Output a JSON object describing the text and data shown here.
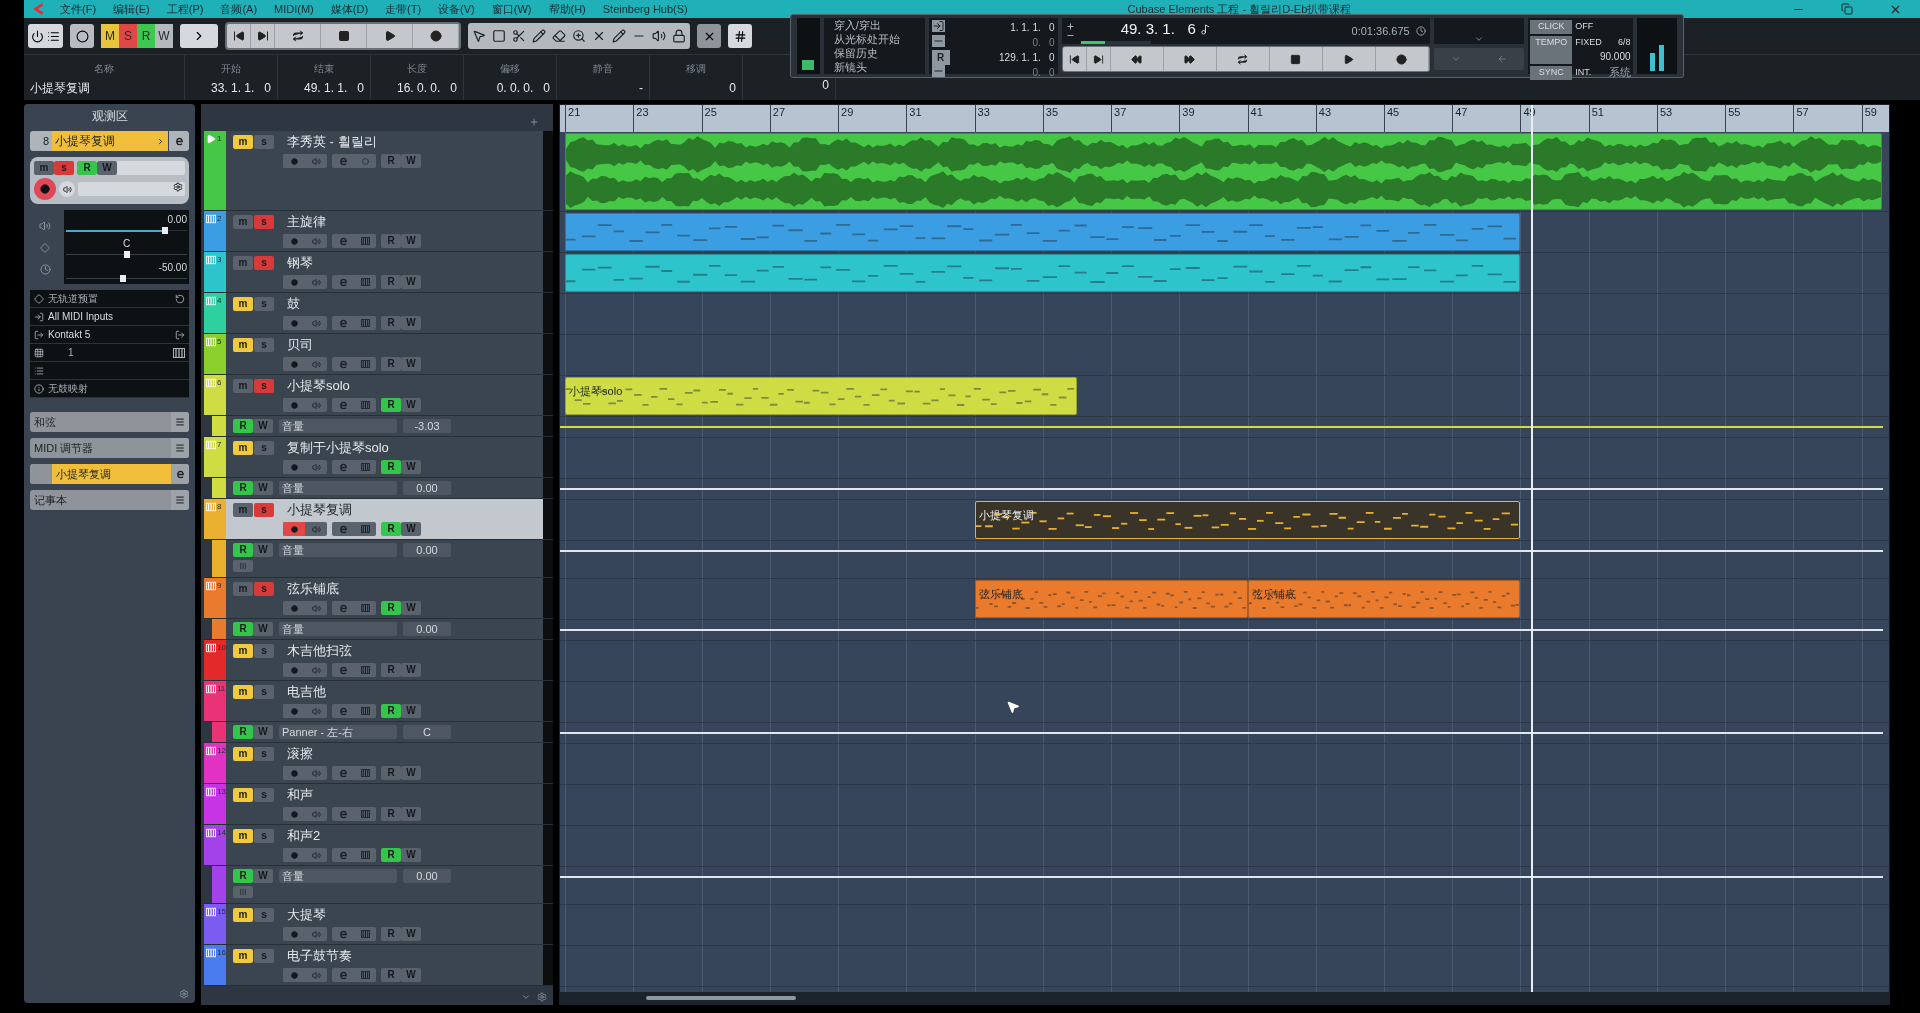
{
  "window": {
    "title": "Cubase Elements 工程 - 휠릴리D-Eb扒带课程"
  },
  "menu": [
    "文件(F)",
    "编辑(E)",
    "工程(P)",
    "音频(A)",
    "MIDI(M)",
    "媒体(D)",
    "走带(T)",
    "设备(V)",
    "窗口(W)",
    "帮助(H)",
    "Steinberg Hub(S)"
  ],
  "toolbar": {
    "states": [
      {
        "label": "M",
        "color": "#e8c43c"
      },
      {
        "label": "S",
        "color": "#e04848"
      },
      {
        "label": "R",
        "color": "#3cc850"
      },
      {
        "label": "W",
        "color": "#b4b9be"
      }
    ]
  },
  "info_line": {
    "fields": [
      {
        "label": "名称",
        "value": "小提琴复调"
      },
      {
        "label": "开始",
        "value": "33. 1. 1.   0"
      },
      {
        "label": "结束",
        "value": "49. 1. 1.   0"
      },
      {
        "label": "长度",
        "value": "16. 0. 0.   0"
      },
      {
        "label": "偏移",
        "value": "0. 0. 0.   0"
      },
      {
        "label": "静音",
        "value": "-"
      },
      {
        "label": "移调",
        "value": "0"
      },
      {
        "value": "0"
      }
    ]
  },
  "transport": {
    "options": [
      "穿入/穿出",
      "从光标处开始",
      "保留历史",
      "新镜头"
    ],
    "left_locator": "1. 1. 1.   0",
    "left_offset": "0.   0",
    "right_label": "R",
    "right_locator": "129. 1. 1.   0",
    "right_offset": "0.   0",
    "position": "49. 3. 1.   6",
    "time": "0:01:36.675",
    "level": 0.35,
    "click": {
      "label": "CLICK",
      "value": "OFF"
    },
    "tempo": {
      "label": "TEMPO",
      "mode": "FIXED",
      "signature": "6/8",
      "value": "90.000"
    },
    "sync": {
      "label": "SYNC",
      "value": "INT.",
      "source": "系统"
    }
  },
  "inspector": {
    "title": "观测区",
    "track": {
      "number": "8",
      "name": "小提琴复调"
    },
    "buttons": [
      {
        "label": "m",
        "on": false
      },
      {
        "label": "s",
        "on": true
      },
      {
        "label": "R",
        "on": true
      },
      {
        "label": "W",
        "on": false
      }
    ],
    "record": true,
    "volume": {
      "value": "0.00",
      "level": 0.82
    },
    "pan": {
      "value": "C",
      "level": 0.5
    },
    "delay": {
      "value": "-50.00",
      "level": 0.47
    },
    "rows": [
      {
        "kind": "preset",
        "text": "无轨道预置"
      },
      {
        "kind": "input",
        "text": "All MIDI Inputs"
      },
      {
        "kind": "output",
        "text": "Kontakt 5"
      },
      {
        "kind": "channel",
        "text": "1"
      },
      {
        "kind": "blank"
      },
      {
        "kind": "map",
        "text": "无鼓映射"
      }
    ],
    "sections": [
      {
        "kind": "plain",
        "label": "和弦"
      },
      {
        "kind": "plain",
        "label": "MIDI 调节器"
      },
      {
        "kind": "channel",
        "label": "小提琴复调"
      },
      {
        "kind": "plain",
        "label": "记事本"
      }
    ]
  },
  "ruler": {
    "bars": [
      "21",
      "23",
      "25",
      "27",
      "29",
      "31",
      "33",
      "35",
      "37",
      "39",
      "41",
      "43",
      "45",
      "47",
      "49",
      "51",
      "53",
      "55",
      "57",
      "59"
    ]
  },
  "tracks": [
    {
      "number": "1",
      "name": "李秀英 - 휠릴리",
      "kind": "audio",
      "color": "#46c846",
      "selected": false,
      "record": false,
      "mute": {
        "label": "m",
        "on": true
      },
      "solo": {
        "label": "s",
        "on": false
      },
      "read": {
        "label": "R",
        "on": false
      },
      "write": {
        "label": "W",
        "on": false
      },
      "clips": [
        {
          "kind": "audio",
          "selected": false
        }
      ]
    },
    {
      "number": "2",
      "name": "主旋律",
      "kind": "instrument",
      "color": "#3c9ee2",
      "selected": false,
      "record": false,
      "mute": {
        "label": "m",
        "on": false
      },
      "solo": {
        "label": "s",
        "on": true
      },
      "read": {
        "label": "R",
        "on": false
      },
      "write": {
        "label": "W",
        "on": false
      },
      "clips": [
        {
          "kind": "notes",
          "selected": false
        }
      ]
    },
    {
      "number": "3",
      "name": "钢琴",
      "kind": "instrument",
      "color": "#2ec4cc",
      "selected": false,
      "record": false,
      "mute": {
        "label": "m",
        "on": false
      },
      "solo": {
        "label": "s",
        "on": true
      },
      "read": {
        "label": "R",
        "on": false
      },
      "write": {
        "label": "W",
        "on": false
      },
      "clips": [
        {
          "kind": "notes",
          "selected": false
        }
      ]
    },
    {
      "number": "4",
      "name": "鼓",
      "kind": "instrument",
      "color": "#2ed0a0",
      "selected": false,
      "record": false,
      "mute": {
        "label": "m",
        "on": true
      },
      "solo": {
        "label": "s",
        "on": false
      },
      "read": {
        "label": "R",
        "on": false
      },
      "write": {
        "label": "W",
        "on": false
      }
    },
    {
      "number": "5",
      "name": "贝司",
      "kind": "instrument",
      "color": "#8cd02e",
      "selected": false,
      "record": false,
      "mute": {
        "label": "m",
        "on": true
      },
      "solo": {
        "label": "s",
        "on": false
      },
      "read": {
        "label": "R",
        "on": false
      },
      "write": {
        "label": "W",
        "on": false
      }
    },
    {
      "number": "6",
      "name": "小提琴solo",
      "kind": "instrument",
      "color": "#cfdc44",
      "selected": false,
      "record": false,
      "mute": {
        "label": "m",
        "on": false
      },
      "solo": {
        "label": "s",
        "on": true
      },
      "read": {
        "label": "R",
        "on": true
      },
      "write": {
        "label": "W",
        "on": false
      },
      "clips": [
        {
          "kind": "notes",
          "label": "小提琴solo",
          "selected": false
        }
      ],
      "automation": [
        {
          "param": "音量",
          "value": "-3.03",
          "color": "#cfdc44",
          "read": {
            "label": "R",
            "on": true
          },
          "write": {
            "label": "W",
            "on": false
          }
        }
      ]
    },
    {
      "number": "7",
      "name": "复制于小提琴solo",
      "kind": "instrument",
      "color": "#cfdc44",
      "selected": false,
      "record": false,
      "mute": {
        "label": "m",
        "on": true
      },
      "solo": {
        "label": "s",
        "on": false
      },
      "read": {
        "label": "R",
        "on": true
      },
      "write": {
        "label": "W",
        "on": false
      },
      "automation": [
        {
          "param": "音量",
          "value": "0.00",
          "color": "#dfe6ee",
          "read": {
            "label": "R",
            "on": true
          },
          "write": {
            "label": "W",
            "on": false
          }
        }
      ]
    },
    {
      "number": "8",
      "name": "小提琴复调",
      "kind": "instrument",
      "color": "#eab030",
      "selected": true,
      "record": true,
      "mute": {
        "label": "m",
        "on": false
      },
      "solo": {
        "label": "s",
        "on": true
      },
      "read": {
        "label": "R",
        "on": true
      },
      "write": {
        "label": "W",
        "on": false
      },
      "clips": [
        {
          "kind": "notes",
          "label": "小提琴复调",
          "selected": true
        }
      ],
      "automation": [
        {
          "param": "音量",
          "value": "0.00",
          "color": "#dfe6ee",
          "lanes_button": true,
          "read": {
            "label": "R",
            "on": true
          },
          "write": {
            "label": "W",
            "on": false
          }
        }
      ]
    },
    {
      "number": "9",
      "name": "弦乐铺底",
      "kind": "instrument",
      "color": "#ea7a2c",
      "selected": false,
      "record": false,
      "mute": {
        "label": "m",
        "on": false
      },
      "solo": {
        "label": "s",
        "on": true
      },
      "read": {
        "label": "R",
        "on": true
      },
      "write": {
        "label": "W",
        "on": false
      },
      "clips": [
        {
          "kind": "notes",
          "label": "弦乐铺底",
          "selected": false
        },
        {
          "kind": "notes",
          "label": "弦乐铺底",
          "selected": false
        }
      ],
      "automation": [
        {
          "param": "音量",
          "value": "0.00",
          "color": "#dfe6ee",
          "read": {
            "label": "R",
            "on": true
          },
          "write": {
            "label": "W",
            "on": false
          }
        }
      ]
    },
    {
      "number": "10",
      "name": "木吉他扫弦",
      "kind": "instrument",
      "color": "#e22a2a",
      "selected": false,
      "record": false,
      "mute": {
        "label": "m",
        "on": true
      },
      "solo": {
        "label": "s",
        "on": false
      },
      "read": {
        "label": "R",
        "on": false
      },
      "write": {
        "label": "W",
        "on": false
      }
    },
    {
      "number": "11",
      "name": "电吉他",
      "kind": "instrument",
      "color": "#ea3276",
      "selected": false,
      "record": false,
      "mute": {
        "label": "m",
        "on": true
      },
      "solo": {
        "label": "s",
        "on": false
      },
      "read": {
        "label": "R",
        "on": true
      },
      "write": {
        "label": "W",
        "on": false
      },
      "automation": [
        {
          "param": "Panner - 左-右",
          "value": "C",
          "color": "#dfe6ee",
          "read": {
            "label": "R",
            "on": true
          },
          "write": {
            "label": "W",
            "on": false
          }
        }
      ]
    },
    {
      "number": "12",
      "name": "滚擦",
      "kind": "instrument",
      "color": "#e232c4",
      "selected": false,
      "record": false,
      "mute": {
        "label": "m",
        "on": true
      },
      "solo": {
        "label": "s",
        "on": false
      },
      "read": {
        "label": "R",
        "on": false
      },
      "write": {
        "label": "W",
        "on": false
      }
    },
    {
      "number": "13",
      "name": "和声",
      "kind": "instrument",
      "color": "#c634e4",
      "selected": false,
      "record": false,
      "mute": {
        "label": "m",
        "on": true
      },
      "solo": {
        "label": "s",
        "on": false
      },
      "read": {
        "label": "R",
        "on": false
      },
      "write": {
        "label": "W",
        "on": false
      }
    },
    {
      "number": "14",
      "name": "和声2",
      "kind": "instrument",
      "color": "#a442ea",
      "selected": false,
      "record": false,
      "mute": {
        "label": "m",
        "on": true
      },
      "solo": {
        "label": "s",
        "on": false
      },
      "read": {
        "label": "R",
        "on": true
      },
      "write": {
        "label": "W",
        "on": false
      },
      "automation": [
        {
          "param": "音量",
          "value": "0.00",
          "color": "#dfe6ee",
          "lanes_button": true,
          "read": {
            "label": "R",
            "on": true
          },
          "write": {
            "label": "W",
            "on": false
          }
        }
      ]
    },
    {
      "number": "15",
      "name": "大提琴",
      "kind": "instrument",
      "color": "#7a5cf0",
      "selected": false,
      "record": false,
      "mute": {
        "label": "m",
        "on": true
      },
      "solo": {
        "label": "s",
        "on": false
      },
      "read": {
        "label": "R",
        "on": false
      },
      "write": {
        "label": "W",
        "on": false
      }
    },
    {
      "number": "16",
      "name": "电子鼓节奏",
      "kind": "instrument",
      "color": "#4a7cf0",
      "selected": false,
      "record": false,
      "mute": {
        "label": "m",
        "on": true
      },
      "solo": {
        "label": "s",
        "on": false
      },
      "read": {
        "label": "R",
        "on": false
      },
      "write": {
        "label": "W",
        "on": false
      }
    }
  ]
}
